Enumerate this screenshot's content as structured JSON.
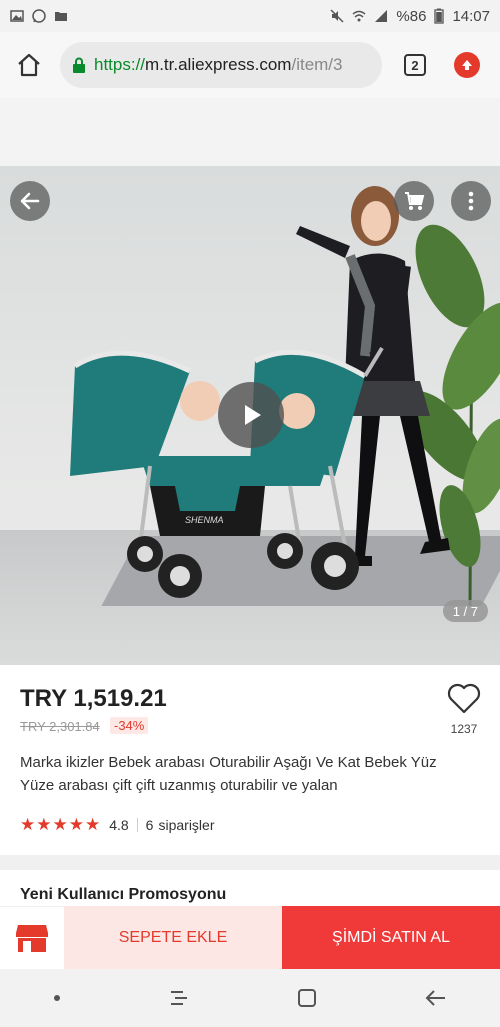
{
  "status_bar": {
    "battery": "%86",
    "time": "14:07"
  },
  "browser": {
    "url_scheme": "https://",
    "url_host": "m.tr.aliexpress.com",
    "url_path": "/item/3",
    "tab_count": "2"
  },
  "gallery": {
    "counter": "1 / 7",
    "brand_on_product": "SHENMA"
  },
  "product": {
    "price": "TRY 1,519.21",
    "old_price": "TRY 2,301.84",
    "discount": "-34%",
    "wishlist_count": "1237",
    "title": "Marka ikizler Bebek arabası Oturabilir Aşağı Ve Kat Bebek Yüz Yüze arabası çift çift uzanmış oturabilir ve yalan",
    "stars": "★★★★★",
    "rating": "4.8",
    "orders_count": "6",
    "orders_label": "siparişler"
  },
  "promo": {
    "title": "Yeni Kullanıcı Promosyonu"
  },
  "actions": {
    "add_to_cart": "SEPETE EKLE",
    "buy_now": "ŞİMDİ SATIN AL"
  },
  "colors": {
    "accent": "#e43a2c",
    "buy_button": "#ef3a39",
    "cart_button_bg": "#fde7e5",
    "url_green": "#0a8a2c",
    "stroller_teal": "#1f7c7a"
  }
}
